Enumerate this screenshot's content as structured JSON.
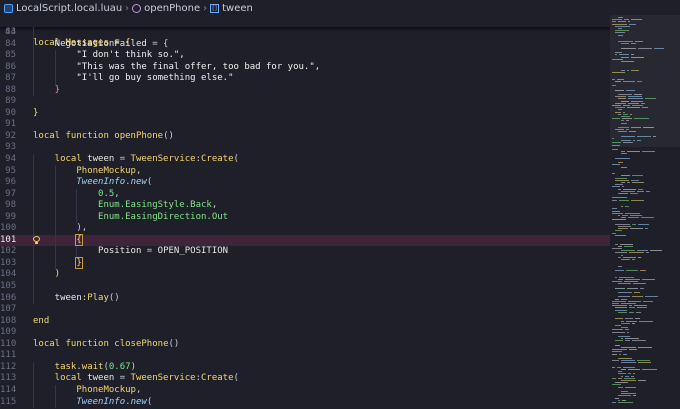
{
  "breadcrumbs": {
    "file": "LocalScript.local.luau",
    "function": "openPhone",
    "variable": "tween"
  },
  "sticky": {
    "line_number": "44",
    "code": "local Messages = {"
  },
  "lines": [
    {
      "n": "83",
      "indent": 1,
      "tokens": []
    },
    {
      "n": "84",
      "indent": 1,
      "tokens": [
        {
          "t": "NegotiationFailed",
          "c": "var"
        },
        {
          "t": " = {",
          "c": "pun"
        }
      ]
    },
    {
      "n": "85",
      "indent": 2,
      "tokens": [
        {
          "t": "\"I don't think so.\",",
          "c": "str"
        }
      ]
    },
    {
      "n": "86",
      "indent": 2,
      "tokens": [
        {
          "t": "\"This was the final offer, too bad for you.\",",
          "c": "str"
        }
      ]
    },
    {
      "n": "87",
      "indent": 2,
      "tokens": [
        {
          "t": "\"I'll go buy something else.\"",
          "c": "str"
        }
      ]
    },
    {
      "n": "88",
      "indent": 1,
      "tokens": [
        {
          "t": "}",
          "c": "pink"
        }
      ]
    },
    {
      "n": "89",
      "indent": 0,
      "tokens": []
    },
    {
      "n": "90",
      "indent": 0,
      "tokens": [
        {
          "t": "}",
          "c": "kw"
        }
      ]
    },
    {
      "n": "91",
      "indent": 0,
      "tokens": []
    },
    {
      "n": "92",
      "indent": 0,
      "tokens": [
        {
          "t": "local ",
          "c": "kw"
        },
        {
          "t": "function ",
          "c": "kw"
        },
        {
          "t": "openPhone",
          "c": "fn"
        },
        {
          "t": "()",
          "c": "pun"
        }
      ]
    },
    {
      "n": "93",
      "indent": 0,
      "tokens": []
    },
    {
      "n": "94",
      "indent": 1,
      "tokens": [
        {
          "t": "local ",
          "c": "kw"
        },
        {
          "t": "tween",
          "c": "var"
        },
        {
          "t": " = ",
          "c": "pun"
        },
        {
          "t": "TweenService",
          "c": "fn"
        },
        {
          "t": ":",
          "c": "pun"
        },
        {
          "t": "Create",
          "c": "fn"
        },
        {
          "t": "(",
          "c": "pun"
        }
      ]
    },
    {
      "n": "95",
      "indent": 2,
      "tokens": [
        {
          "t": "PhoneMockup",
          "c": "fn"
        },
        {
          "t": ",",
          "c": "pun"
        }
      ]
    },
    {
      "n": "96",
      "indent": 2,
      "tokens": [
        {
          "t": "TweenInfo",
          "c": "cls"
        },
        {
          "t": ".",
          "c": "pun"
        },
        {
          "t": "new",
          "c": "cls"
        },
        {
          "t": "(",
          "c": "pun"
        }
      ]
    },
    {
      "n": "97",
      "indent": 3,
      "tokens": [
        {
          "t": "0.5",
          "c": "num"
        },
        {
          "t": ",",
          "c": "pun"
        }
      ]
    },
    {
      "n": "98",
      "indent": 3,
      "tokens": [
        {
          "t": "Enum.EasingStyle.Back",
          "c": "grn"
        },
        {
          "t": ",",
          "c": "pun"
        }
      ]
    },
    {
      "n": "99",
      "indent": 3,
      "tokens": [
        {
          "t": "Enum.EasingDirection.Out",
          "c": "grn"
        }
      ]
    },
    {
      "n": "100",
      "indent": 2,
      "tokens": [
        {
          "t": "),",
          "c": "pun"
        }
      ]
    },
    {
      "n": "101",
      "indent": 2,
      "tokens": [
        {
          "t": "{",
          "c": "kw",
          "brk": true
        }
      ],
      "highlight": true,
      "bulb": true,
      "active": true
    },
    {
      "n": "102",
      "indent": 3,
      "tokens": [
        {
          "t": "Position",
          "c": "var"
        },
        {
          "t": " = ",
          "c": "pun"
        },
        {
          "t": "OPEN_POSITION",
          "c": "var"
        }
      ]
    },
    {
      "n": "103",
      "indent": 2,
      "tokens": [
        {
          "t": "}",
          "c": "kw",
          "brk": true
        }
      ]
    },
    {
      "n": "104",
      "indent": 1,
      "tokens": [
        {
          "t": ")",
          "c": "kw"
        }
      ]
    },
    {
      "n": "105",
      "indent": 1,
      "tokens": []
    },
    {
      "n": "106",
      "indent": 1,
      "tokens": [
        {
          "t": "tween",
          "c": "var"
        },
        {
          "t": ":",
          "c": "pun"
        },
        {
          "t": "Play",
          "c": "fn"
        },
        {
          "t": "()",
          "c": "pun"
        }
      ]
    },
    {
      "n": "107",
      "indent": 0,
      "tokens": []
    },
    {
      "n": "108",
      "indent": 0,
      "tokens": [
        {
          "t": "end",
          "c": "kw"
        }
      ]
    },
    {
      "n": "109",
      "indent": 0,
      "tokens": []
    },
    {
      "n": "110",
      "indent": 0,
      "tokens": [
        {
          "t": "local ",
          "c": "kw"
        },
        {
          "t": "function ",
          "c": "kw"
        },
        {
          "t": "closePhone",
          "c": "fn"
        },
        {
          "t": "()",
          "c": "pun"
        }
      ]
    },
    {
      "n": "111",
      "indent": 0,
      "tokens": []
    },
    {
      "n": "112",
      "indent": 1,
      "tokens": [
        {
          "t": "task",
          "c": "fn"
        },
        {
          "t": ".",
          "c": "pun"
        },
        {
          "t": "wait",
          "c": "fn"
        },
        {
          "t": "(",
          "c": "pun"
        },
        {
          "t": "0.67",
          "c": "num"
        },
        {
          "t": ")",
          "c": "pun"
        }
      ]
    },
    {
      "n": "113",
      "indent": 1,
      "tokens": [
        {
          "t": "local ",
          "c": "kw"
        },
        {
          "t": "tween",
          "c": "var"
        },
        {
          "t": " = ",
          "c": "pun"
        },
        {
          "t": "TweenService",
          "c": "fn"
        },
        {
          "t": ":",
          "c": "pun"
        },
        {
          "t": "Create",
          "c": "fn"
        },
        {
          "t": "(",
          "c": "pun"
        }
      ]
    },
    {
      "n": "114",
      "indent": 2,
      "tokens": [
        {
          "t": "PhoneMockup",
          "c": "fn"
        },
        {
          "t": ",",
          "c": "pun"
        }
      ]
    },
    {
      "n": "115",
      "indent": 2,
      "tokens": [
        {
          "t": "TweenInfo",
          "c": "cls"
        },
        {
          "t": ".",
          "c": "pun"
        },
        {
          "t": "new",
          "c": "cls"
        },
        {
          "t": "(",
          "c": "pun"
        }
      ]
    }
  ],
  "colors": {
    "background": "#1e1f29",
    "keyword": "#f5d76e",
    "number": "#7ee787",
    "class": "#9ad4ff",
    "highlight": "#41243a"
  }
}
